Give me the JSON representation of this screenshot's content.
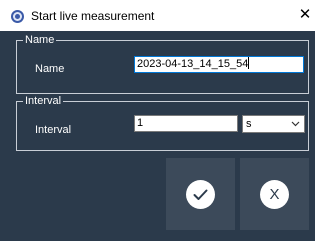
{
  "window": {
    "title": "Start live measurement",
    "close_glyph": "✕",
    "app_icon": "measurement-app-icon"
  },
  "name_group": {
    "legend": "Name",
    "label": "Name",
    "value": "2023-04-13_14_15_54"
  },
  "interval_group": {
    "legend": "Interval",
    "label": "Interval",
    "value": "1",
    "unit_selected": "s"
  },
  "buttons": {
    "confirm_icon": "checkmark-icon",
    "cancel_label": "X"
  },
  "colors": {
    "background": "#2b3a4b",
    "button": "#3c4a5a",
    "focus_border": "#0078d7"
  }
}
